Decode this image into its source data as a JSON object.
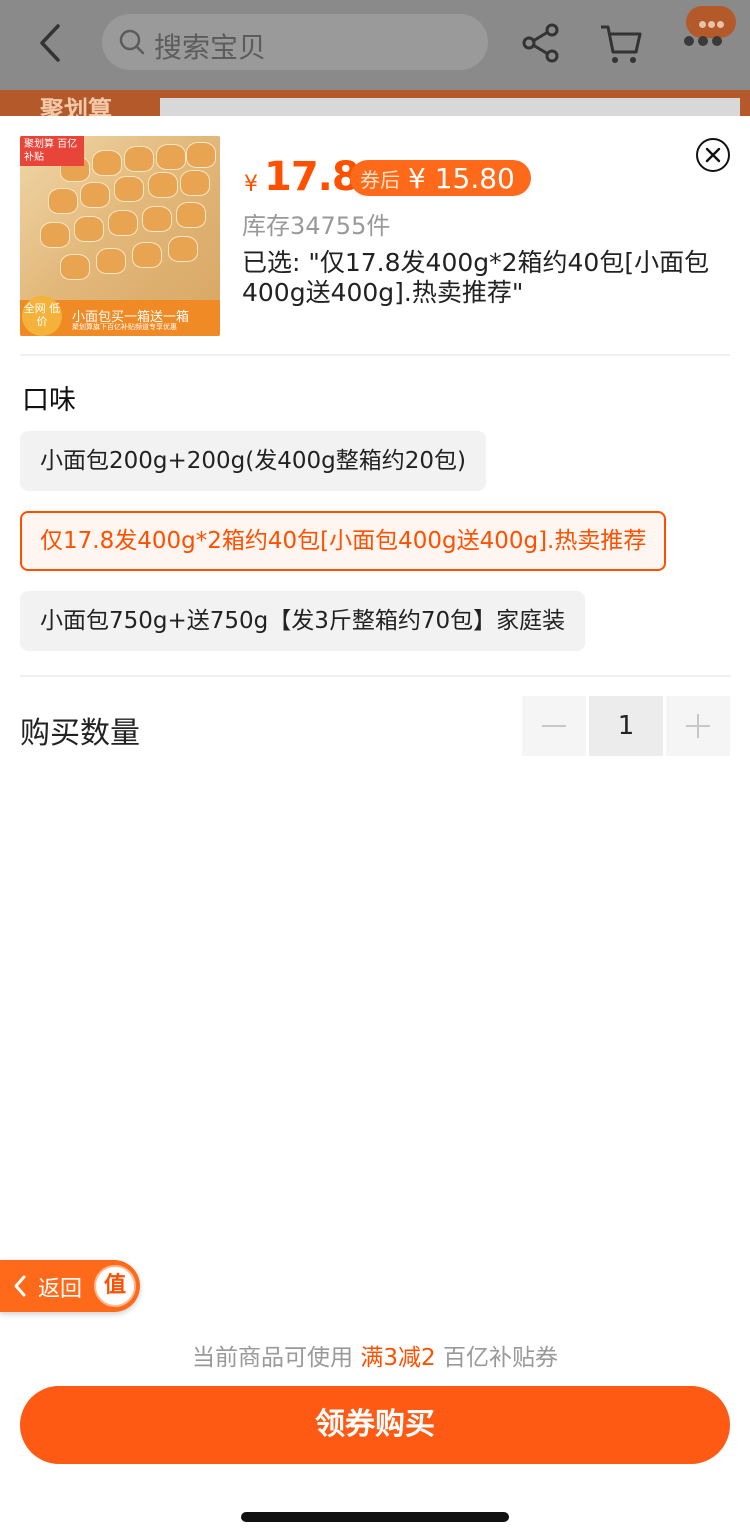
{
  "header": {
    "search_placeholder": "搜索宝贝",
    "banner_text": "聚划算"
  },
  "product": {
    "thumb_tag": "聚划算 百亿补贴",
    "thumb_circle": "全网 低价",
    "thumb_caption": "小面包买一箱送一箱",
    "thumb_subcaption": "聚划算旗下百亿补贴频道专享优惠",
    "currency_symbol": "¥",
    "price": "17.8",
    "coupon_label": "券后",
    "coupon_price": "¥ 15.80",
    "stock": "库存34755件",
    "selected": "已选: \"仅17.8发400g*2箱约40包[小面包400g送400g].热卖推荐\""
  },
  "flavor": {
    "title": "口味",
    "options": [
      {
        "label": "小面包200g+200g(发400g整箱约20包)",
        "selected": false
      },
      {
        "label": "仅17.8发400g*2箱约40包[小面包400g送400g].热卖推荐",
        "selected": true
      },
      {
        "label": "小面包750g+送750g【发3斤整箱约70包】家庭装",
        "selected": false
      }
    ]
  },
  "quantity": {
    "title": "购买数量",
    "value": "1"
  },
  "floating": {
    "return_label": "返回",
    "badge": "值"
  },
  "footer": {
    "coupon_prefix": "当前商品可使用",
    "coupon_highlight": "满3减2",
    "coupon_suffix": "百亿补贴券",
    "buy_label": "领券购买"
  },
  "colors": {
    "accent": "#ff5000",
    "button": "#ff5a14"
  }
}
